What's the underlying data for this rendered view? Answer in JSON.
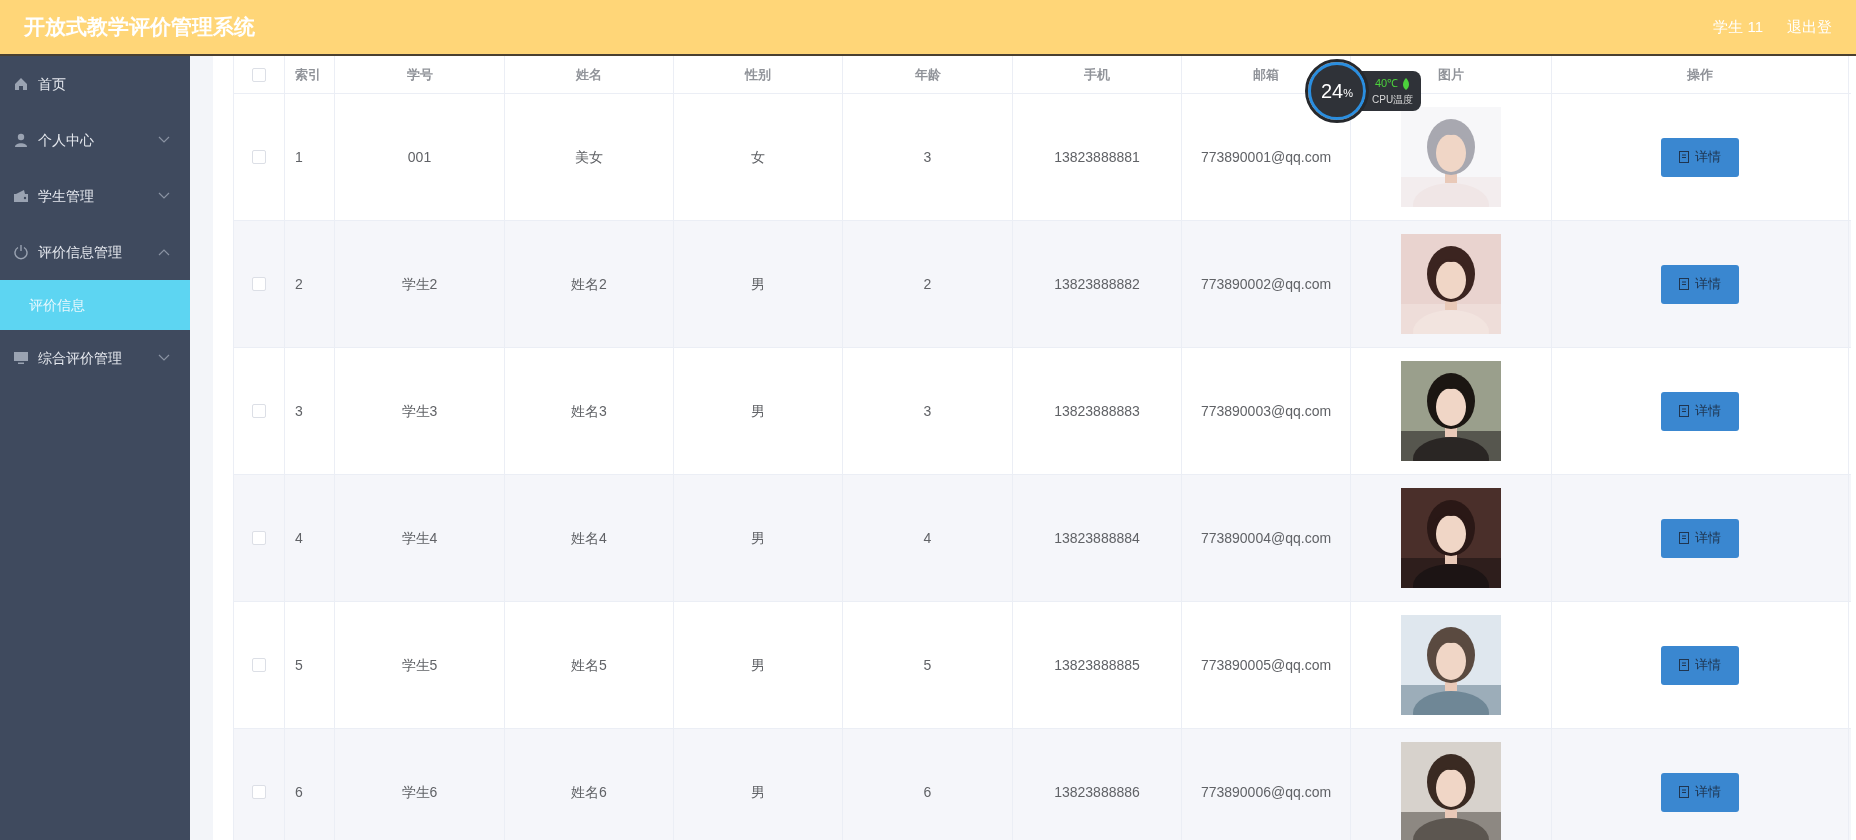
{
  "header": {
    "title": "开放式教学评价管理系统",
    "user": "学生 11",
    "logout": "退出登"
  },
  "sidebar": {
    "items": [
      {
        "label": "首页",
        "kind": "link"
      },
      {
        "label": "个人中心",
        "kind": "menu",
        "expanded": false
      },
      {
        "label": "学生管理",
        "kind": "menu",
        "expanded": false
      },
      {
        "label": "评价信息管理",
        "kind": "menu",
        "expanded": true,
        "children": [
          {
            "label": "评价信息",
            "selected": true
          }
        ]
      },
      {
        "label": "综合评价管理",
        "kind": "menu",
        "expanded": false
      }
    ]
  },
  "table": {
    "all_checked": false,
    "columns": [
      "索引",
      "学号",
      "姓名",
      "性别",
      "年龄",
      "手机",
      "邮箱",
      "图片",
      "操作"
    ],
    "rows": [
      {
        "checked": false,
        "cells": [
          "1",
          "001",
          "美女",
          "女",
          "3",
          "13823888881",
          "773890001@qq.com"
        ],
        "action": "详情"
      },
      {
        "checked": false,
        "cells": [
          "2",
          "学生2",
          "姓名2",
          "男",
          "2",
          "13823888882",
          "773890002@qq.com"
        ],
        "action": "详情"
      },
      {
        "checked": false,
        "cells": [
          "3",
          "学生3",
          "姓名3",
          "男",
          "3",
          "13823888883",
          "773890003@qq.com"
        ],
        "action": "详情"
      },
      {
        "checked": false,
        "cells": [
          "4",
          "学生4",
          "姓名4",
          "男",
          "4",
          "13823888884",
          "773890004@qq.com"
        ],
        "action": "详情"
      },
      {
        "checked": false,
        "cells": [
          "5",
          "学生5",
          "姓名5",
          "男",
          "5",
          "13823888885",
          "773890005@qq.com"
        ],
        "action": "详情"
      },
      {
        "checked": false,
        "cells": [
          "6",
          "学生6",
          "姓名6",
          "男",
          "6",
          "13823888886",
          "773890006@qq.com"
        ],
        "action": "详情"
      }
    ]
  },
  "cpu_widget": {
    "percent": "24",
    "unit": "%",
    "temperature": "40℃",
    "label": "CPU温度"
  }
}
